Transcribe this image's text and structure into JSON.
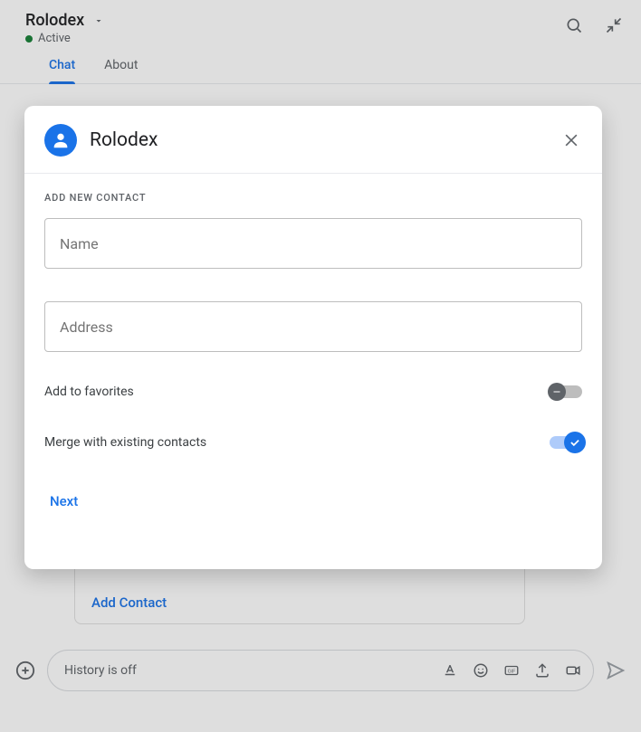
{
  "header": {
    "title": "Rolodex",
    "status": "Active"
  },
  "tabs": {
    "chat": "Chat",
    "about": "About"
  },
  "background_card": {
    "link": "Add Contact"
  },
  "composer": {
    "text": "History is off"
  },
  "modal": {
    "title": "Rolodex",
    "section_label": "ADD NEW CONTACT",
    "name_placeholder": "Name",
    "address_placeholder": "Address",
    "favorites_label": "Add to favorites",
    "favorites_on": false,
    "merge_label": "Merge with existing contacts",
    "merge_on": true,
    "next_label": "Next"
  }
}
